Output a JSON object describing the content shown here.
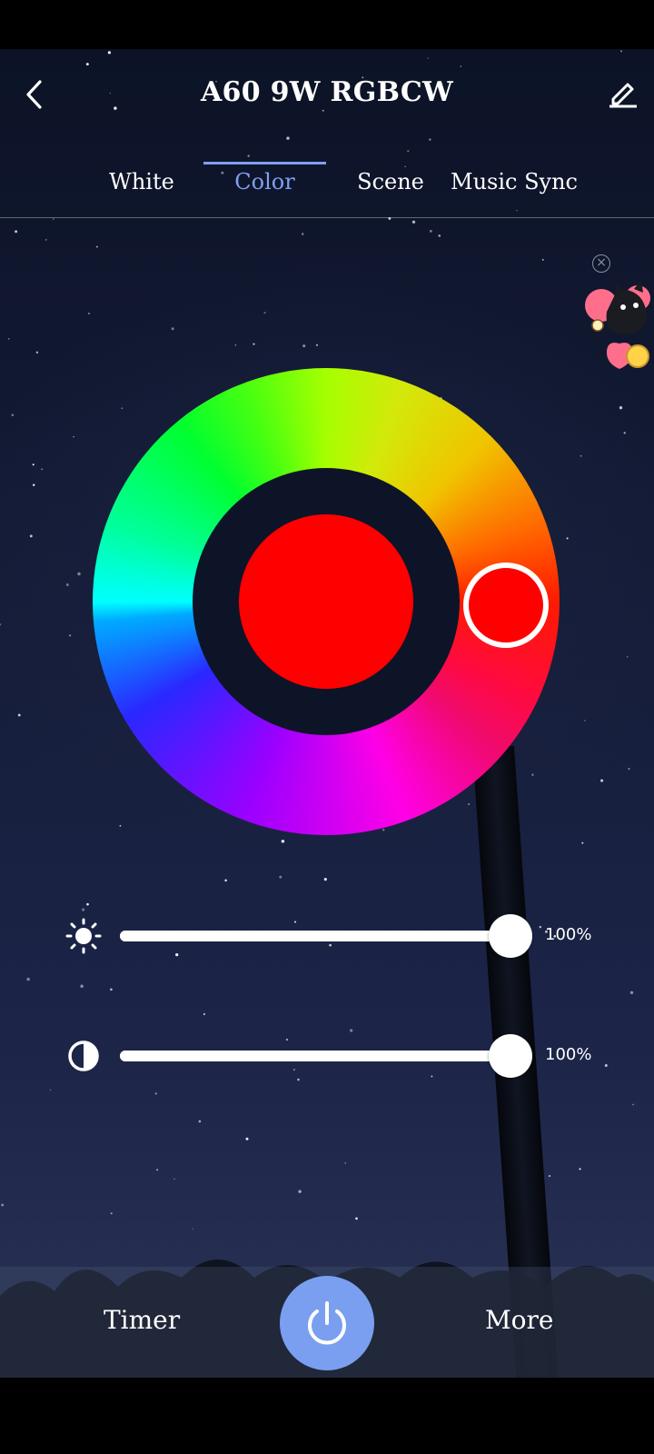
{
  "header": {
    "title": "A60  9W RGBCW"
  },
  "icons": {
    "back": "chevron-left-icon",
    "edit": "pencil-icon",
    "brightness": "sun-icon",
    "saturation": "half-circle-icon",
    "power": "power-icon",
    "ad_close": "close-circle-icon"
  },
  "tabs": [
    {
      "label": "White",
      "active": false
    },
    {
      "label": "Color",
      "active": true
    },
    {
      "label": "Scene",
      "active": false
    },
    {
      "label": "Music Sync",
      "active": false
    }
  ],
  "color_wheel": {
    "selected_color": "#ff0000",
    "ring_background": "#0e1428"
  },
  "sliders": {
    "brightness": {
      "value_label": "100%",
      "value": 100
    },
    "saturation": {
      "value_label": "100%",
      "value": 100
    }
  },
  "bottom": {
    "timer_label": "Timer",
    "more_label": "More"
  },
  "colors": {
    "accent": "#7f9ff0",
    "power_button": "#7b9ff0"
  }
}
